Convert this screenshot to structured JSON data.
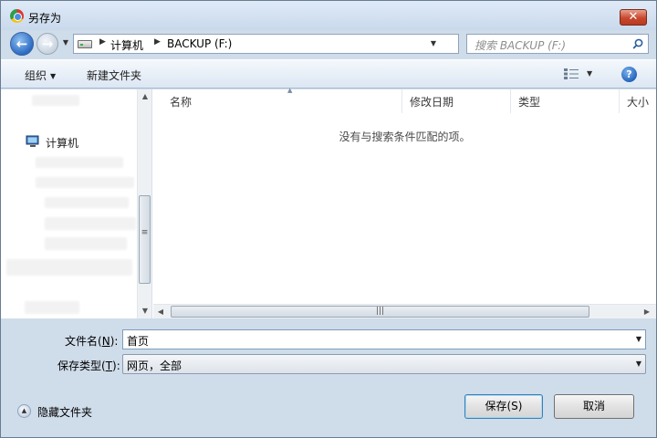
{
  "window": {
    "title": "另存为",
    "close_label": "✕"
  },
  "navigation": {
    "breadcrumb": [
      "计算机",
      "BACKUP (F:)"
    ],
    "search_placeholder": "搜索 BACKUP (F:)"
  },
  "toolbar": {
    "organize_label": "组织",
    "new_folder_label": "新建文件夹",
    "help_label": "?"
  },
  "sidebar": {
    "computer_label": "计算机"
  },
  "file_list": {
    "columns": [
      "名称",
      "修改日期",
      "类型",
      "大小"
    ],
    "empty_message": "没有与搜索条件匹配的项。"
  },
  "form": {
    "filename_label": "文件名",
    "filename_key": "N",
    "filename_value": "首页",
    "filetype_label": "保存类型",
    "filetype_key": "T",
    "filetype_value": "网页，全部"
  },
  "footer": {
    "hide_folders_label": "隐藏文件夹",
    "save_label": "保存(S)",
    "cancel_label": "取消"
  },
  "colors": {
    "accent": "#2c6bc4",
    "window_frame": "#cfdcea",
    "close_button": "#c8472e"
  }
}
